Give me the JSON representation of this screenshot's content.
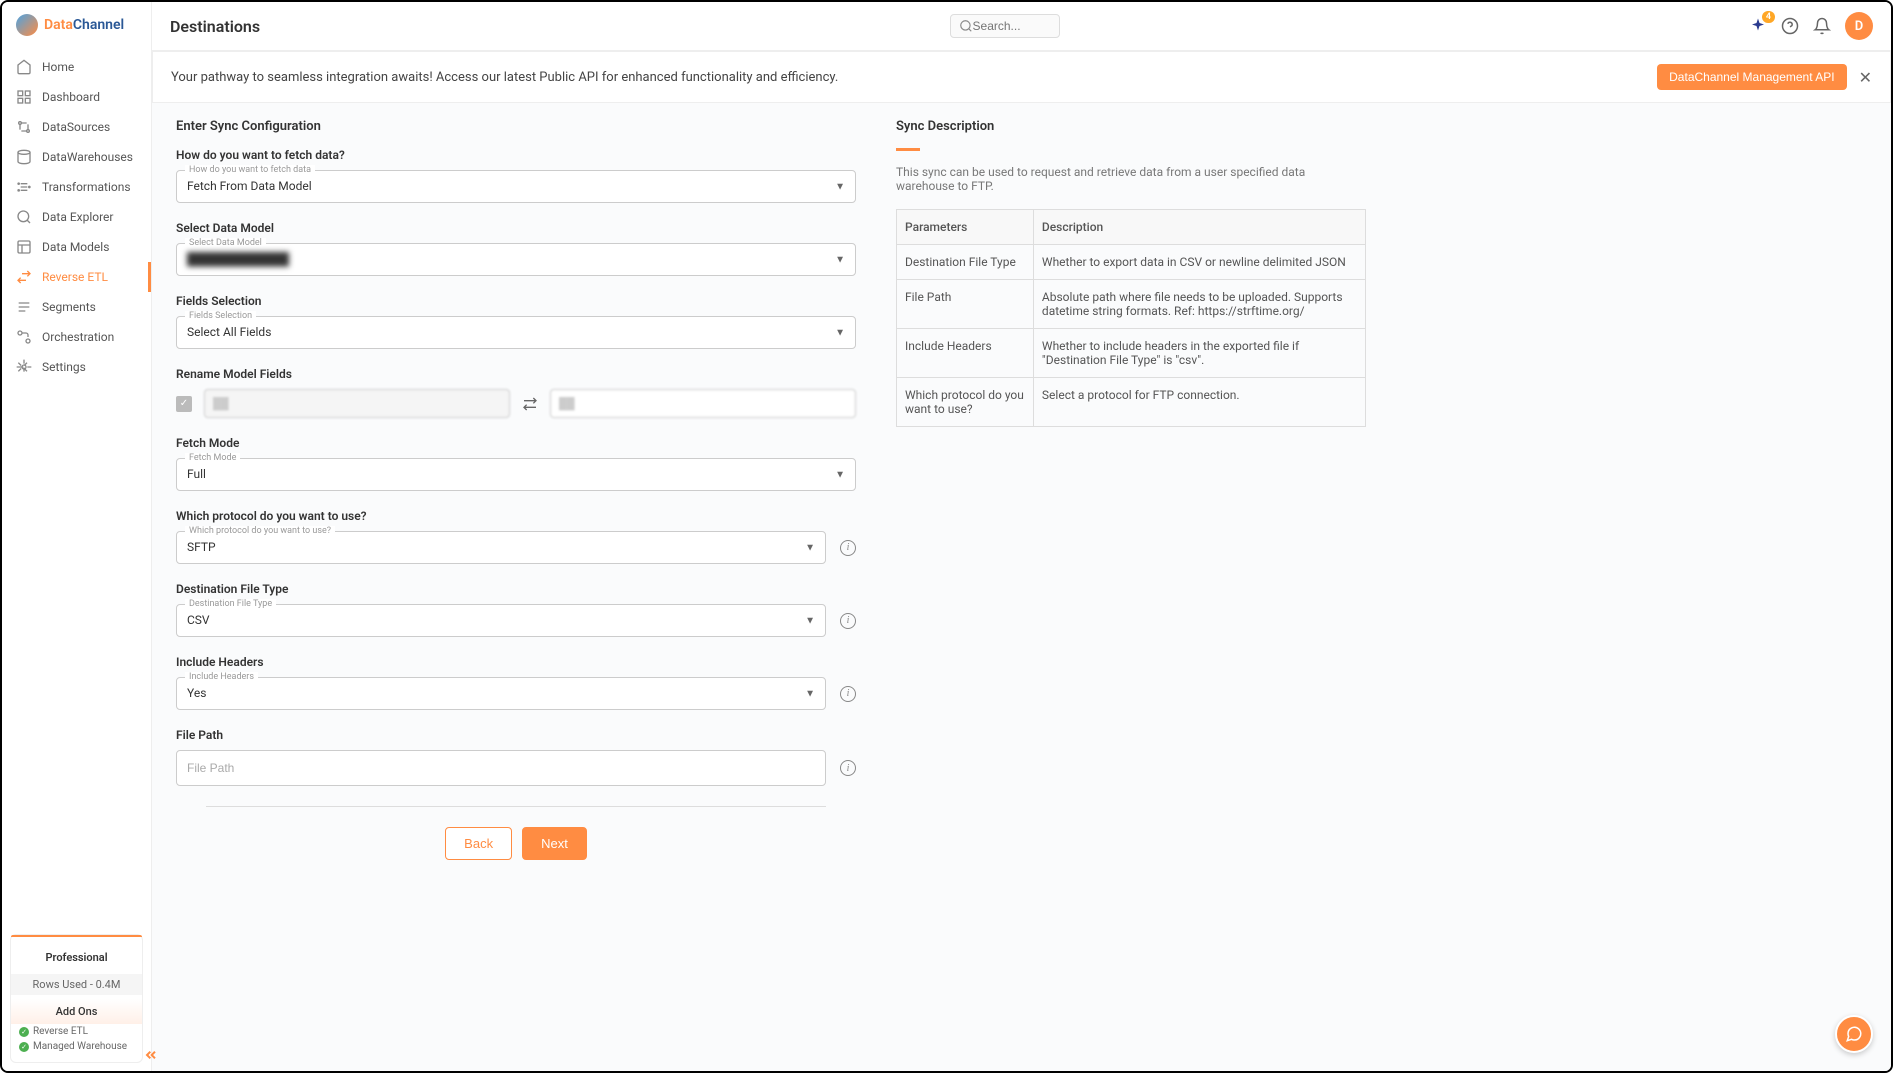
{
  "brand": {
    "part1": "Data",
    "part2": "Channel"
  },
  "sidebar": {
    "items": [
      {
        "label": "Home"
      },
      {
        "label": "Dashboard"
      },
      {
        "label": "DataSources"
      },
      {
        "label": "DataWarehouses"
      },
      {
        "label": "Transformations"
      },
      {
        "label": "Data Explorer"
      },
      {
        "label": "Data Models"
      },
      {
        "label": "Reverse ETL"
      },
      {
        "label": "Segments"
      },
      {
        "label": "Orchestration"
      },
      {
        "label": "Settings"
      }
    ]
  },
  "plan": {
    "name": "Professional",
    "rows": "Rows Used - 0.4M",
    "addons_title": "Add Ons",
    "addons": [
      "Reverse ETL",
      "Managed Warehouse"
    ]
  },
  "topbar": {
    "title": "Destinations",
    "search_placeholder": "Search...",
    "badge": "4",
    "avatar": "D"
  },
  "banner": {
    "text": "Your pathway to seamless integration awaits! Access our latest Public API for enhanced functionality and efficiency.",
    "button": "DataChannel Management API"
  },
  "form": {
    "title": "Enter Sync Configuration",
    "fetch_question": "How do you want to fetch data?",
    "fetch_floating": "How do you want to fetch data",
    "fetch_value": "Fetch From Data Model",
    "model_label": "Select Data Model",
    "model_floating": "Select Data Model",
    "model_value": "████████████",
    "fields_label": "Fields Selection",
    "fields_floating": "Fields Selection",
    "fields_value": "Select All Fields",
    "rename_label": "Rename Model Fields",
    "fetch_mode_label": "Fetch Mode",
    "fetch_mode_floating": "Fetch Mode",
    "fetch_mode_value": "Full",
    "protocol_label": "Which protocol do you want to use?",
    "protocol_floating": "Which protocol do you want to use?",
    "protocol_value": "SFTP",
    "dest_type_label": "Destination File Type",
    "dest_type_floating": "Destination File Type",
    "dest_type_value": "CSV",
    "headers_label": "Include Headers",
    "headers_floating": "Include Headers",
    "headers_value": "Yes",
    "filepath_label": "File Path",
    "filepath_placeholder": "File Path",
    "back": "Back",
    "next": "Next"
  },
  "desc": {
    "title": "Sync Description",
    "text": "This sync can be used to request and retrieve data from a user specified data warehouse to FTP.",
    "headers": {
      "param": "Parameters",
      "description": "Description"
    },
    "rows": [
      {
        "param": "Destination File Type",
        "desc": "Whether to export data in CSV or newline delimited JSON"
      },
      {
        "param": "File Path",
        "desc": "Absolute path where file needs to be uploaded. Supports datetime string formats. Ref: https://strftime.org/"
      },
      {
        "param": "Include Headers",
        "desc": "Whether to include headers in the exported file if \"Destination File Type\" is \"csv\"."
      },
      {
        "param": "Which protocol do you want to use?",
        "desc": "Select a protocol for FTP connection."
      }
    ]
  }
}
